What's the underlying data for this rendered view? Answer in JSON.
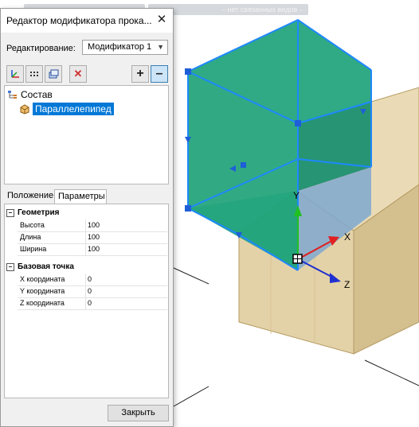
{
  "top_bar": {
    "chip_2": "– нет связанных видов –"
  },
  "dialog": {
    "title": "Редактор модификатора прока...",
    "close_glyph": "✕",
    "edit_label": "Редактирование:",
    "modifier_value": "Модификатор 1",
    "tree": {
      "root_label": "Состав",
      "child_label": "Параллелепипед"
    },
    "tabs": [
      {
        "label": "Положение",
        "active": false
      },
      {
        "label": "Параметры",
        "active": true
      }
    ],
    "groups": {
      "geometry": {
        "label": "Геометрия",
        "rows": [
          {
            "key": "Высота",
            "value": "100"
          },
          {
            "key": "Длина",
            "value": "100"
          },
          {
            "key": "Ширина",
            "value": "100"
          }
        ]
      },
      "base_point": {
        "label": "Базовая точка",
        "rows": [
          {
            "key": "X координата",
            "value": "0"
          },
          {
            "key": "Y координата",
            "value": "0"
          },
          {
            "key": "Z координата",
            "value": "0"
          }
        ]
      }
    },
    "close_button": "Закрыть"
  },
  "scene": {
    "axis_x": "X",
    "axis_y": "Y",
    "axis_z": "Z"
  },
  "colors": {
    "selection_green": "#20a87a",
    "selection_edge": "#1e90ff",
    "solid_tan": "#e3d2a8"
  }
}
